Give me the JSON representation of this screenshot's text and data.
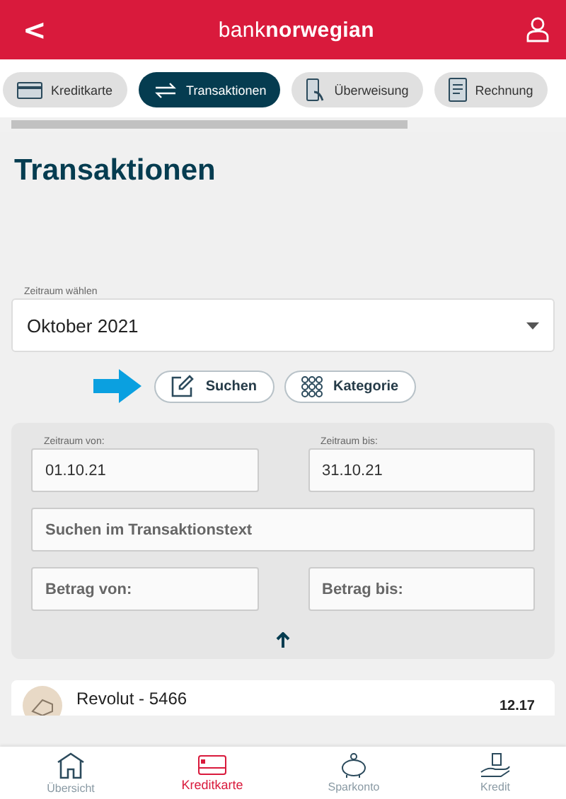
{
  "header": {
    "back": "<",
    "logo_light": "bank",
    "logo_bold": "norwegian"
  },
  "tabs": [
    {
      "label": "Kreditkarte",
      "kind": "card",
      "selected": false
    },
    {
      "label": "Transaktionen",
      "kind": "transfer",
      "selected": true
    },
    {
      "label": "Überweisung",
      "kind": "phone",
      "selected": false
    },
    {
      "label": "Rechnung",
      "kind": "invoice",
      "selected": false
    }
  ],
  "title": "Transaktionen",
  "period_select": {
    "label": "Zeitraum wählen",
    "value": "Oktober 2021"
  },
  "actions": [
    {
      "label": "Suchen",
      "kind": "edit"
    },
    {
      "label": "Kategorie",
      "kind": "grid"
    }
  ],
  "filters": {
    "from": {
      "label": "Zeitraum von:",
      "value": "01.10.21"
    },
    "to": {
      "label": "Zeitraum bis:",
      "value": "31.10.21"
    },
    "search": {
      "placeholder": "Suchen im Transaktionstext"
    },
    "amount_from": {
      "placeholder": "Betrag von:"
    },
    "amount_to": {
      "placeholder": "Betrag bis:"
    }
  },
  "transaction": {
    "name": "Revolut - 5466",
    "amount": "12.17"
  },
  "bottom_nav": [
    {
      "label": "Übersicht",
      "kind": "home",
      "selected": false
    },
    {
      "label": "Kreditkarte",
      "kind": "card",
      "selected": true
    },
    {
      "label": "Sparkonto",
      "kind": "piggy",
      "selected": false
    },
    {
      "label": "Kredit",
      "kind": "loan",
      "selected": false
    }
  ]
}
